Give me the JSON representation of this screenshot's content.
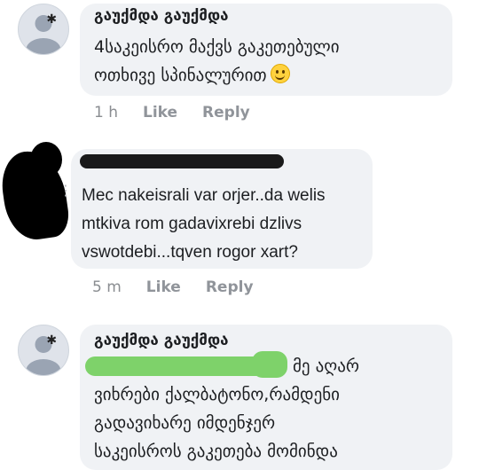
{
  "comments": [
    {
      "author": "გაუქმდა გაუქმდა",
      "lines": [
        "4საკეისრო მაქვს გაკეთებული",
        "ოთხივე სპინალურით"
      ],
      "time": "1 h",
      "like_label": "Like",
      "reply_label": "Reply",
      "emoji": "smiling-face"
    },
    {
      "author": "",
      "lines": [
        "Mec nakeisrali var  orjer..da welis",
        "mtkiva rom gadavixrebi dzlivs",
        "vswotdebi...tqven rogor xart?"
      ],
      "time": "5 m",
      "like_label": "Like",
      "reply_label": "Reply"
    },
    {
      "author": "გაუქმდა გაუქმდა",
      "lines": [
        "მე აღარ",
        "ვიხრები ქალბატონო,რამდენი",
        "გადავიხარე იმდენჯერ",
        "საკეისროს გაკეთება მომინდა"
      ]
    }
  ]
}
